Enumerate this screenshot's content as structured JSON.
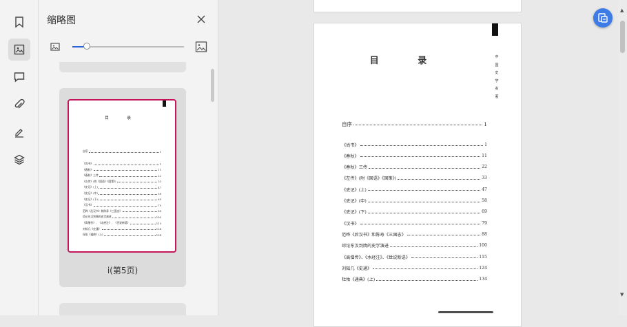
{
  "sidebar": {
    "items": [
      {
        "icon": "bookmark-icon",
        "active": false
      },
      {
        "icon": "thumbnail-icon",
        "active": true
      },
      {
        "icon": "comment-icon",
        "active": false
      },
      {
        "icon": "attachment-icon",
        "active": false
      },
      {
        "icon": "sign-icon",
        "active": false
      },
      {
        "icon": "layers-icon",
        "active": false
      }
    ]
  },
  "panel": {
    "title": "缩略图",
    "zoom_level": 0.13,
    "thumbnail": {
      "label": "i(第5页)",
      "selected_border": "#c2185b"
    }
  },
  "document": {
    "toc_title": "目  录",
    "side_text": [
      "中",
      "国",
      "史",
      "学",
      "名",
      "著"
    ],
    "entries": [
      {
        "label": "自序",
        "page": "1"
      },
      {
        "label": "《尚书》",
        "page": "1"
      },
      {
        "label": "《春秋》",
        "page": "11"
      },
      {
        "label": "《春秋》三传",
        "page": "22"
      },
      {
        "label": "《左传》(附《国语》《国策》)",
        "page": "33"
      },
      {
        "label": "《史记》(上)",
        "page": "47"
      },
      {
        "label": "《史记》(中)",
        "page": "58"
      },
      {
        "label": "《史记》(下)",
        "page": "69"
      },
      {
        "label": "《汉书》",
        "page": "79"
      },
      {
        "label": "范晔《后汉书》和陈寿《三国志》",
        "page": "88"
      },
      {
        "label": "综论东汉到隋的史学演进",
        "page": "100"
      },
      {
        "label": "《高僧传》、《水经注》、《世说新语》",
        "page": "115"
      },
      {
        "label": "刘知几《史通》",
        "page": "124"
      },
      {
        "label": "杜佑《通典》(上)",
        "page": "134"
      }
    ]
  },
  "colors": {
    "accent": "#2a64d8",
    "float_button": "#3d7be6"
  }
}
